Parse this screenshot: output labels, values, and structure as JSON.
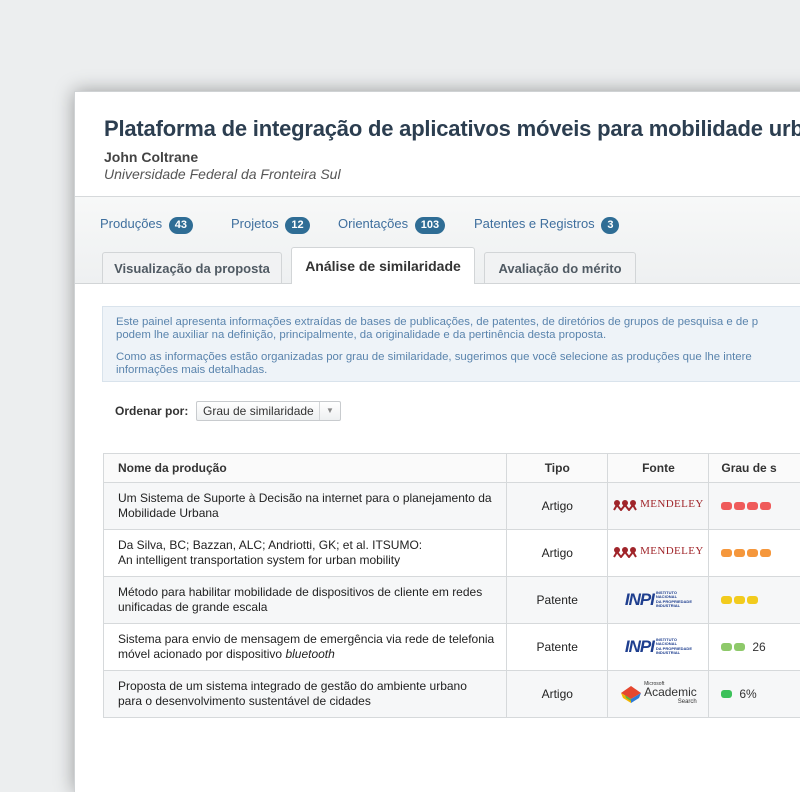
{
  "proposal": {
    "title": "Plataforma de integração de aplicativos móveis para mobilidade urbana",
    "author": "John Coltrane",
    "institution": "Universidade Federal da Fronteira Sul"
  },
  "counts": [
    {
      "label": "Produções",
      "count": "43"
    },
    {
      "label": "Projetos",
      "count": "12"
    },
    {
      "label": "Orientações",
      "count": "103"
    },
    {
      "label": "Patentes e Registros",
      "count": "3"
    }
  ],
  "tabs": [
    {
      "label": "Visualização da proposta",
      "active": false
    },
    {
      "label": "Análise de similaridade",
      "active": true
    },
    {
      "label": "Avaliação do mérito",
      "active": false
    }
  ],
  "info": {
    "p1_line1": "Este painel apresenta informações extraídas de bases de publicações, de patentes, de diretórios de grupos de pesquisa e de p",
    "p1_line2": "podem lhe auxiliar na definição, principalmente, da originalidade e da pertinência desta proposta.",
    "p2_line1": "Como as informações estão organizadas por grau de similaridade, sugerimos que você selecione as produções que lhe intere",
    "p2_line2": "informações mais detalhadas."
  },
  "sort": {
    "label": "Ordenar por:",
    "selected": "Grau de similaridade"
  },
  "table": {
    "headers": [
      "Nome da produção",
      "Tipo",
      "Fonte",
      "Grau de s"
    ],
    "rows": [
      {
        "name_line1": "Um Sistema de Suporte à Decisão na internet para o planejamento da",
        "name_line2": "Mobilidade Urbana",
        "type": "Artigo",
        "source": "MENDELEY",
        "bars": 4,
        "color": "#ef5b5b",
        "pct": ""
      },
      {
        "name_line1": "Da Silva, BC; Bazzan, ALC; Andriotti, GK; et al. ITSUMO:",
        "name_line2": "An intelligent transportation system for urban mobility",
        "type": "Artigo",
        "source": "MENDELEY",
        "bars": 4,
        "color": "#f5973c",
        "pct": ""
      },
      {
        "name_line1": "Método para habilitar mobilidade de dispositivos de cliente em redes",
        "name_line2": "unificadas de grande escala",
        "type": "Patente",
        "source": "INPI",
        "bars": 3,
        "color": "#f2cb1d",
        "pct": ""
      },
      {
        "name_line1": "Sistema para envio de mensagem de emergência via rede de telefonia",
        "name_line2": "móvel acionado por dispositivo ",
        "name_line2_em": "bluetooth",
        "type": "Patente",
        "source": "INPI",
        "bars": 2,
        "color": "#8ec96a",
        "pct": "26"
      },
      {
        "name_line1": "Proposta de um sistema integrado de gestão do ambiente urbano",
        "name_line2": "para o desenvolvimento sustentável de cidades",
        "type": "Artigo",
        "source": "Academic",
        "bars": 1,
        "color": "#3cc15a",
        "pct": "6%"
      }
    ]
  },
  "logos": {
    "mendeley": "MENDELEY",
    "inpi_big": "INPI",
    "inpi_small_1": "INSTITUTO",
    "inpi_small_2": "NACIONAL",
    "inpi_small_3": "DA PROPRIEDADE",
    "inpi_small_4": "INDUSTRIAL",
    "academic_ms": "Microsoft",
    "academic": "Academic",
    "academic_search": "Search",
    "academic_beta": "Beta"
  }
}
